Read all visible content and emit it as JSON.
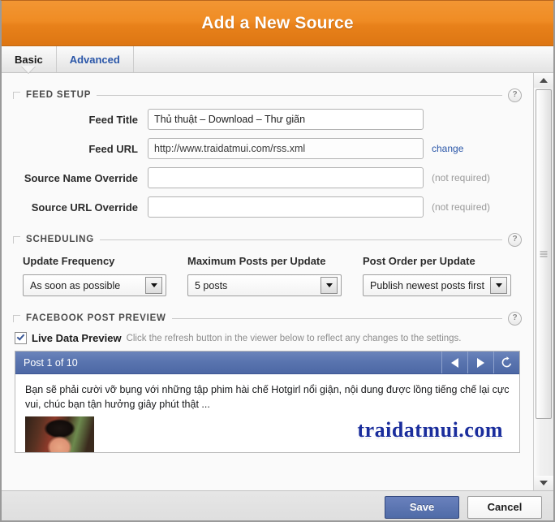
{
  "window": {
    "title": "Add a New Source"
  },
  "tabs": [
    {
      "label": "Basic",
      "active": true
    },
    {
      "label": "Advanced",
      "active": false
    }
  ],
  "sections": {
    "feed_setup": {
      "title": "FEED SETUP",
      "help": "?",
      "fields": [
        {
          "label": "Feed Title",
          "value": "Thủ thuật – Download – Thư giãn",
          "placeholder": "",
          "suffix": ""
        },
        {
          "label": "Feed URL",
          "value": "http://www.traidatmui.com/rss.xml",
          "placeholder": "",
          "suffix": "change"
        },
        {
          "label": "Source Name Override",
          "value": "",
          "placeholder": "",
          "suffix": "(not required)"
        },
        {
          "label": "Source URL Override",
          "value": "",
          "placeholder": "",
          "suffix": "(not required)"
        }
      ]
    },
    "scheduling": {
      "title": "SCHEDULING",
      "help": "?",
      "selects": [
        {
          "label": "Update Frequency",
          "value": "As soon as possible"
        },
        {
          "label": "Maximum Posts per Update",
          "value": "5 posts"
        },
        {
          "label": "Post Order per Update",
          "value": "Publish newest posts first"
        }
      ]
    },
    "preview": {
      "title": "FACEBOOK POST PREVIEW",
      "help": "?",
      "checkbox_label": "Live Data Preview",
      "checkbox_hint": "Click the refresh button in the viewer below to reflect any changes to the settings.",
      "checked": true,
      "viewer": {
        "title": "Post 1 of 10",
        "prev_label": "◀",
        "next_label": "▶",
        "refresh_label": "↻",
        "post_text": "Bạn sẽ phải cười vỡ bụng với những tập phim hài chế Hotgirl nổi giận, nội dung được lồng tiếng chế lại cực vui, chúc bạn tận hưởng giây phút thật ...",
        "watermark": "traidatmui.com"
      }
    }
  },
  "footer": {
    "save_label": "Save",
    "cancel_label": "Cancel"
  },
  "colors": {
    "header_orange": "#ef8c24",
    "link_blue": "#2a56a8",
    "viewer_blue": "#5873ae",
    "primary_button": "#4f6ba7"
  }
}
